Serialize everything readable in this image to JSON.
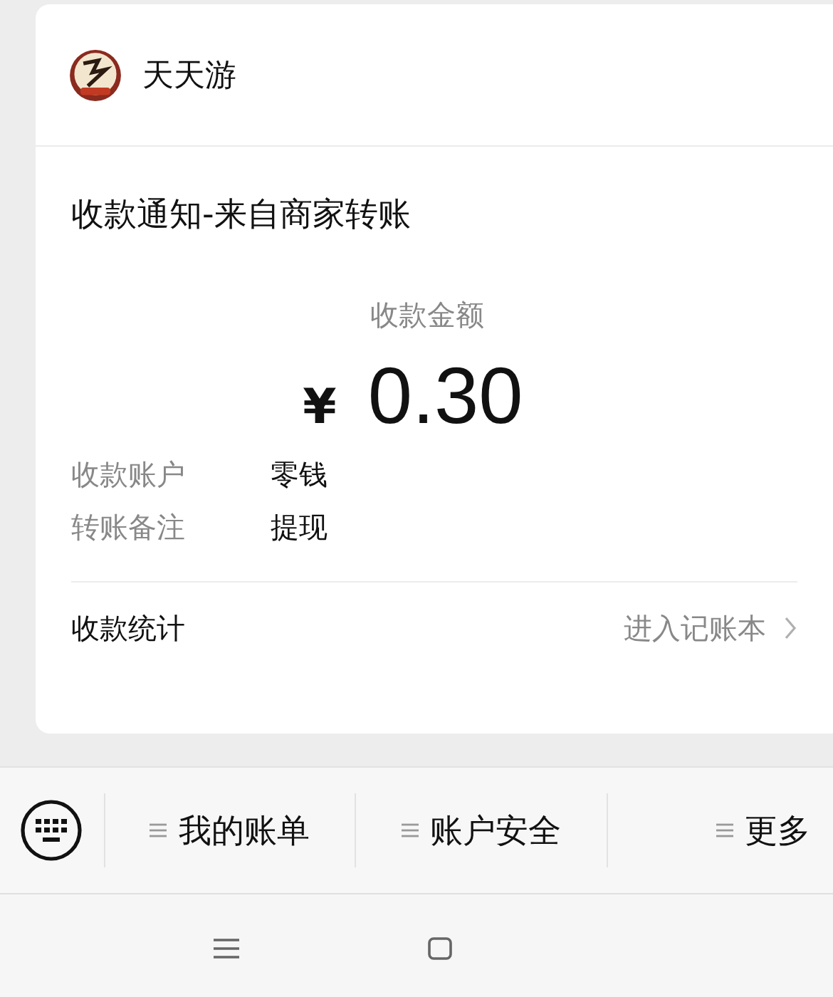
{
  "card": {
    "sender": {
      "name": "天天游"
    },
    "title": "收款通知-来自商家转账",
    "amount_label": "收款金额",
    "currency": "¥",
    "amount": "0.30",
    "details": [
      {
        "label": "收款账户",
        "value": "零钱"
      },
      {
        "label": "转账备注",
        "value": "提现"
      }
    ],
    "footer": {
      "label": "收款统计",
      "link": "进入记账本"
    }
  },
  "menu": {
    "items": [
      {
        "label": "我的账单"
      },
      {
        "label": "账户安全"
      },
      {
        "label": "更多"
      }
    ]
  }
}
